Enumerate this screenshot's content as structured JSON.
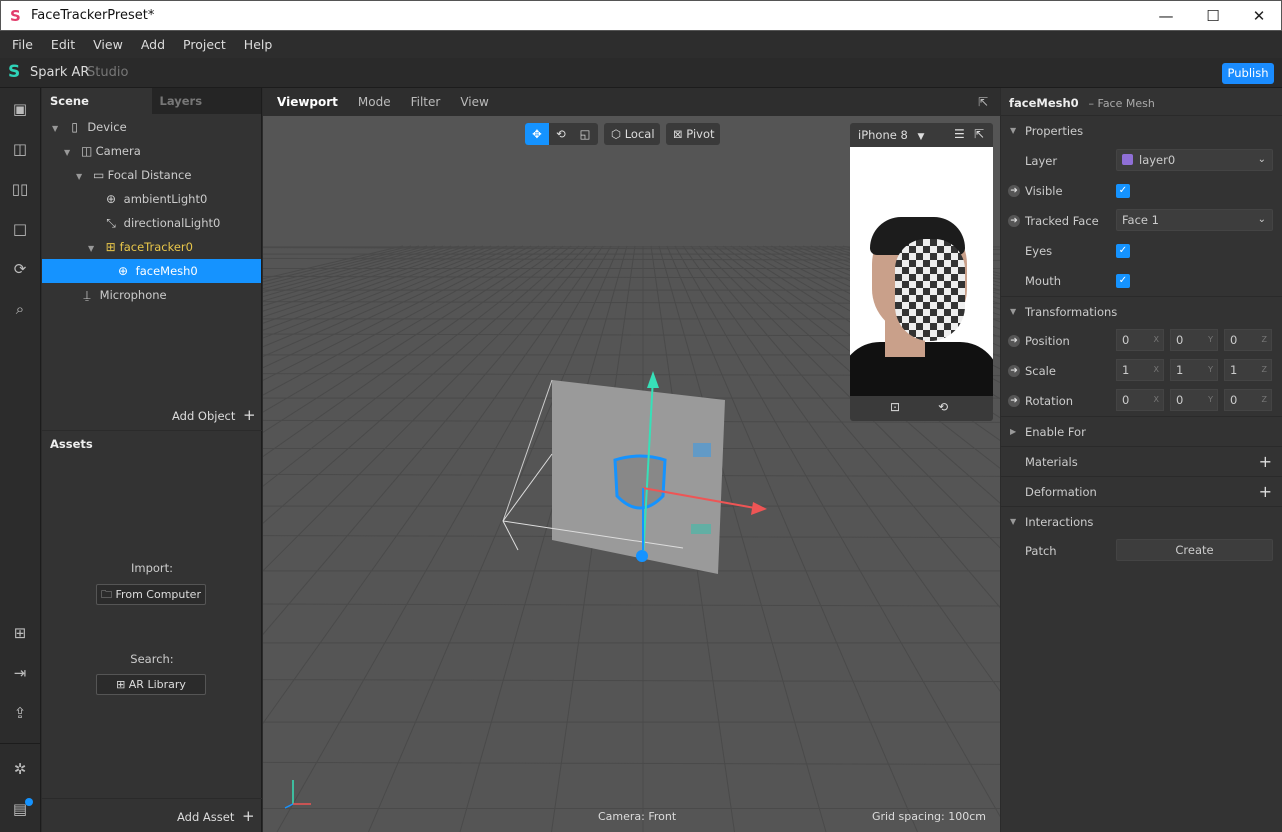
{
  "window": {
    "title": "FaceTrackerPreset*",
    "min": "—",
    "max": "☐",
    "close": "✕"
  },
  "menu": [
    "File",
    "Edit",
    "View",
    "Add",
    "Project",
    "Help"
  ],
  "app": {
    "brand_a": "Spark AR",
    "brand_b": "Studio",
    "publish": "Publish"
  },
  "scene": {
    "tabs": [
      "Scene",
      "Layers"
    ],
    "items": [
      {
        "label": "Device",
        "icon": "phone-icon"
      },
      {
        "label": "Camera",
        "icon": "camera-icon"
      },
      {
        "label": "Focal Distance",
        "icon": "ruler-icon"
      },
      {
        "label": "ambientLight0",
        "icon": "globe-icon"
      },
      {
        "label": "directionalLight0",
        "icon": "directional-light-icon"
      },
      {
        "label": "faceTracker0",
        "icon": "face-tracker-icon"
      },
      {
        "label": "faceMesh0",
        "icon": "mesh-icon"
      },
      {
        "label": "Microphone",
        "icon": "microphone-icon"
      }
    ],
    "add_object": "Add Object"
  },
  "assets": {
    "title": "Assets",
    "import_label": "Import:",
    "from_computer": "From Computer",
    "search_label": "Search:",
    "ar_library": "AR Library",
    "add_asset": "Add Asset"
  },
  "viewport": {
    "tabs": [
      "Viewport",
      "Mode",
      "Filter",
      "View"
    ],
    "local": "Local",
    "pivot": "Pivot",
    "device": "iPhone 8",
    "camera": "Camera: Front",
    "grid": "Grid spacing: 100cm"
  },
  "props": {
    "name": "faceMesh0",
    "type": "– Face Mesh",
    "properties": "Properties",
    "layer_label": "Layer",
    "layer_value": "layer0",
    "layer_color": "#8f6fd6",
    "visible": "Visible",
    "tracked_face": "Tracked Face",
    "tracked_face_value": "Face 1",
    "eyes": "Eyes",
    "mouth": "Mouth",
    "transformations": "Transformations",
    "position": "Position",
    "position_v": [
      "0",
      "0",
      "0"
    ],
    "scale": "Scale",
    "scale_v": [
      "1",
      "1",
      "1"
    ],
    "rotation": "Rotation",
    "rotation_v": [
      "0",
      "0",
      "0"
    ],
    "axes": [
      "X",
      "Y",
      "Z"
    ],
    "enable_for": "Enable For",
    "materials": "Materials",
    "deformation": "Deformation",
    "interactions": "Interactions",
    "patch": "Patch",
    "create": "Create"
  },
  "colors": {
    "accent": "#1593ff",
    "tracker": "#e8c64a"
  }
}
